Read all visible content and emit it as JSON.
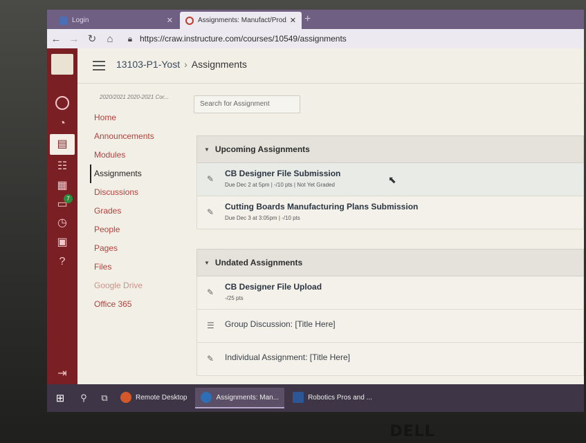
{
  "browser": {
    "tabs": [
      {
        "title": "Login",
        "close": "✕",
        "favicon_color": "#4a6fb5"
      },
      {
        "title": "Assignments: Manufact/Prod. I-P",
        "close": "✕",
        "favicon_color": "#c0392b"
      }
    ],
    "new_tab": "+",
    "url": "https://craw.instructure.com/courses/10549/assignments"
  },
  "global_nav": {
    "items": [
      {
        "name": "account",
        "icon": "user-circle-icon"
      },
      {
        "name": "dashboard",
        "icon": "dashboard-icon"
      },
      {
        "name": "courses",
        "icon": "book-icon"
      },
      {
        "name": "groups",
        "icon": "groups-icon"
      },
      {
        "name": "calendar",
        "icon": "calendar-icon"
      },
      {
        "name": "inbox",
        "icon": "inbox-icon",
        "badge": "7"
      },
      {
        "name": "history",
        "icon": "clock-icon"
      },
      {
        "name": "commons",
        "icon": "commons-icon"
      },
      {
        "name": "help",
        "icon": "help-icon"
      }
    ],
    "collapse_icon": "collapse-arrow-icon"
  },
  "header": {
    "course": "13103-P1-Yost",
    "separator": "›",
    "current": "Assignments"
  },
  "course_nav": {
    "term": "2020/2021 2020-2021 Cor...",
    "items": [
      {
        "label": "Home",
        "state": "normal"
      },
      {
        "label": "Announcements",
        "state": "normal"
      },
      {
        "label": "Modules",
        "state": "normal"
      },
      {
        "label": "Assignments",
        "state": "active"
      },
      {
        "label": "Discussions",
        "state": "normal"
      },
      {
        "label": "Grades",
        "state": "normal"
      },
      {
        "label": "People",
        "state": "normal"
      },
      {
        "label": "Pages",
        "state": "normal"
      },
      {
        "label": "Files",
        "state": "normal"
      },
      {
        "label": "Google Drive",
        "state": "disabled"
      },
      {
        "label": "Office 365",
        "state": "normal"
      }
    ]
  },
  "search": {
    "placeholder": "Search for Assignment"
  },
  "groups": [
    {
      "title": "Upcoming Assignments",
      "caret": "▼",
      "rows": [
        {
          "title": "CB Designer File Submission",
          "meta": "Due Dec 2 at 5pm  |  -/10 pts  |  Not Yet Graded",
          "icon": "assignment-icon",
          "highlight": true
        },
        {
          "title": "Cutting Boards Manufacturing Plans Submission",
          "meta": "Due Dec 3 at 3:05pm  |  -/10 pts",
          "icon": "assignment-icon",
          "highlight": false
        }
      ]
    },
    {
      "title": "Undated Assignments",
      "caret": "▼",
      "rows": [
        {
          "title": "CB Designer File Upload",
          "meta": "-/25 pts",
          "icon": "assignment-icon",
          "highlight": false
        },
        {
          "title": "Group Discussion: [Title Here]",
          "meta": "",
          "icon": "discussion-icon",
          "highlight": false
        },
        {
          "title": "Individual Assignment: [Title Here]",
          "meta": "",
          "icon": "assignment-icon",
          "highlight": false
        }
      ]
    }
  ],
  "taskbar": {
    "apps": [
      {
        "label": "Remote Desktop",
        "color": "#d4582a",
        "active": false
      },
      {
        "label": "Assignments: Man...",
        "color": "#2c6fb6",
        "active": true
      },
      {
        "label": "Robotics Pros and ...",
        "color": "#2b5797",
        "active": false
      }
    ]
  },
  "monitor": {
    "brand": "DELL"
  }
}
